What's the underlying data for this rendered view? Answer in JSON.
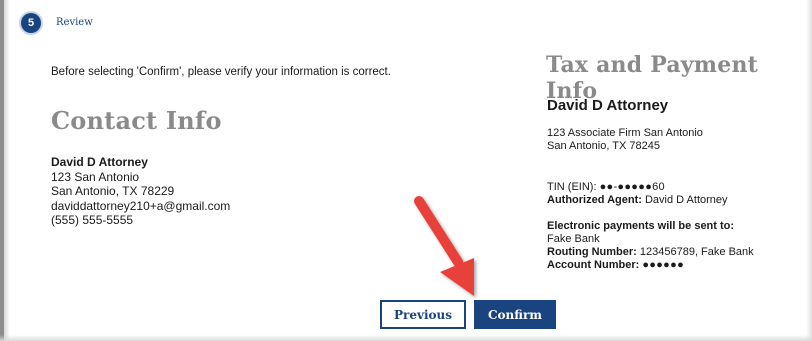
{
  "step": {
    "number": "5",
    "label": "Review"
  },
  "verify_text": "Before selecting 'Confirm', please verify your information is correct.",
  "contact": {
    "title": "Contact Info",
    "name": "David D Attorney",
    "address1": "123 San Antonio",
    "address2": "San Antonio, TX 78229",
    "email": "daviddattorney210+a@gmail.com",
    "phone": "(555) 555-5555"
  },
  "tax": {
    "title": "Tax and Payment Info",
    "name": "David D Attorney",
    "address1": "123 Associate Firm San Antonio",
    "address2": "San Antonio, TX 78245",
    "tin_label": "TIN (EIN):",
    "tin_value": "●●-●●●●●60",
    "agent_label": "Authorized Agent:",
    "agent_value": "David D Attorney",
    "payments_heading": "Electronic payments will be sent to:",
    "bank": "Fake Bank",
    "routing_label": "Routing Number:",
    "routing_value": "123456789, Fake Bank",
    "account_label": "Account Number:",
    "account_value": "●●●●●●"
  },
  "buttons": {
    "previous": "Previous",
    "confirm": "Confirm"
  },
  "colors": {
    "primary": "#1a4480",
    "heading_gray": "#8a8a8a",
    "arrow": "#e8403a"
  }
}
